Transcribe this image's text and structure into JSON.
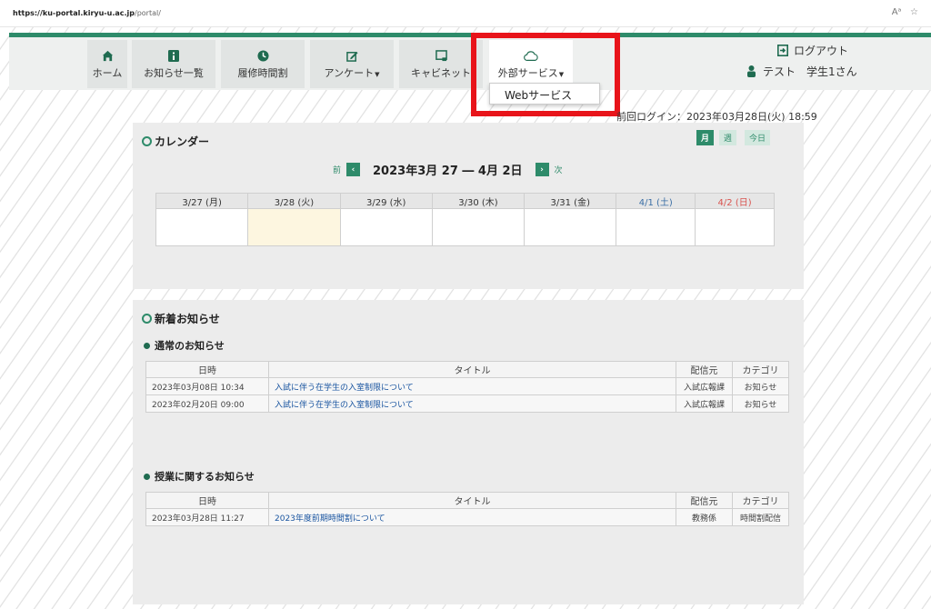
{
  "browser": {
    "url_host": "https://ku-portal.kiryu-u.ac.jp",
    "url_path": "/portal/",
    "reader_icon": "Aᵃ",
    "fav_icon": "☆"
  },
  "nav": {
    "items": [
      {
        "label": "ホーム",
        "icon": "home-icon"
      },
      {
        "label": "お知らせ一覧",
        "icon": "info-icon"
      },
      {
        "label": "履修時間割",
        "icon": "clock-icon"
      },
      {
        "label": "アンケート",
        "icon": "edit-icon"
      },
      {
        "label": "キャビネット",
        "icon": "cabinet-icon"
      },
      {
        "label": "外部サービス",
        "icon": "cloud-icon"
      }
    ],
    "dropdown_item": "Webサービス",
    "logout": "ログアウト",
    "user": "テスト　学生1さん"
  },
  "last_login": "前回ログイン：2023年03月28日(火) 18:59",
  "calendar": {
    "title": "カレンダー",
    "view_buttons": [
      "月",
      "週",
      "今日"
    ],
    "prev": "前",
    "next": "次",
    "range": "2023年3月 27 ― 4月 2日",
    "days": [
      "3/27 (月)",
      "3/28 (火)",
      "3/29 (水)",
      "3/30 (木)",
      "3/31 (金)",
      "4/1 (土)",
      "4/2 (日)"
    ]
  },
  "news": {
    "title": "新着お知らせ",
    "headers": [
      "日時",
      "タイトル",
      "配信元",
      "カテゴリ"
    ],
    "general": {
      "title": "通常のお知らせ",
      "rows": [
        {
          "date": "2023年03月08日 10:34",
          "title": "入試に伴う在学生の入室制限について",
          "from": "入試広報課",
          "category": "お知らせ"
        },
        {
          "date": "2023年02月20日 09:00",
          "title": "入試に伴う在学生の入室制限について",
          "from": "入試広報課",
          "category": "お知らせ"
        }
      ]
    },
    "class": {
      "title": "授業に関するお知らせ",
      "rows": [
        {
          "date": "2023年03月28日 11:27",
          "title": "2023年度前期時間割について",
          "from": "教務係",
          "category": "時間割配信"
        }
      ]
    }
  },
  "colors": {
    "accent": "#2e8b6a",
    "highlight": "#e8141a",
    "link": "#1a55a0"
  }
}
